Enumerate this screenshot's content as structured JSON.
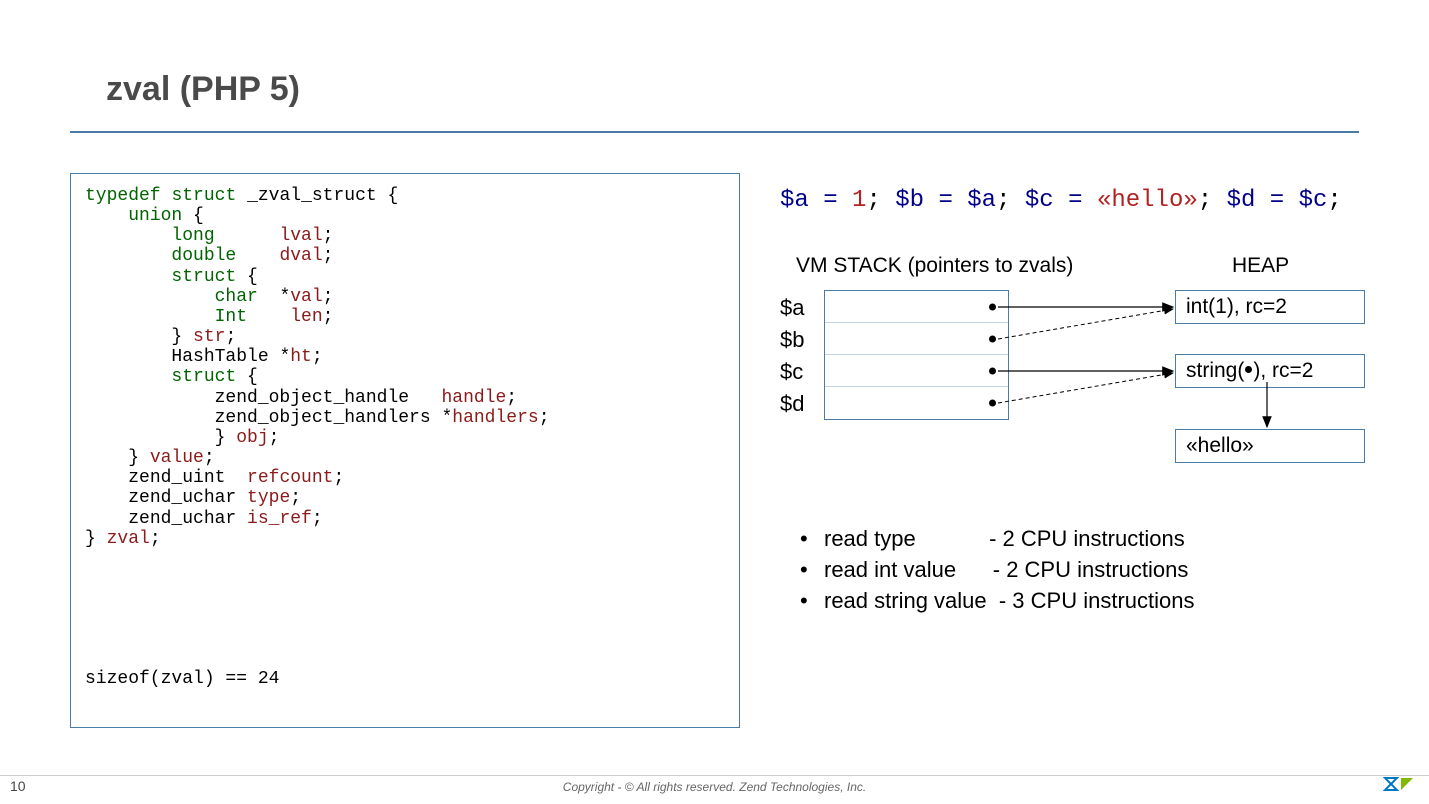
{
  "title": "zval (PHP 5)",
  "code": {
    "l1a": "typedef",
    "l1b": "struct",
    "l1c": "_zval_struct {",
    "l2a": "union",
    "l2b": " {",
    "l3a": "long",
    "l3b": "lval",
    "l3c": ";",
    "l4a": "double",
    "l4b": "dval",
    "l4c": ";",
    "l5a": "struct",
    "l5b": " {",
    "l6a": "char",
    "l6b": "  *",
    "l6c": "val",
    "l6d": ";",
    "l7a": "Int",
    "l7b": "len",
    "l7c": ";",
    "l8a": "} ",
    "l8b": "str",
    "l8c": ";",
    "l9a": "HashTable *",
    "l9b": "ht",
    "l9c": ";",
    "l10a": "struct",
    "l10b": " {",
    "l11a": "zend_object_handle",
    "l11b": "handle",
    "l11c": ";",
    "l12a": "zend_object_handlers *",
    "l12b": "handlers",
    "l12c": ";",
    "l13a": "} ",
    "l13b": "obj",
    "l13c": ";",
    "l14a": "} ",
    "l14b": "value",
    "l14c": ";",
    "l15a": "zend_uint  ",
    "l15b": "refcount",
    "l15c": ";",
    "l16a": "zend_uchar ",
    "l16b": "type",
    "l16c": ";",
    "l17a": "zend_uchar ",
    "l17b": "is_ref",
    "l17c": ";",
    "l18a": "} ",
    "l18b": "zval",
    "l18c": ";",
    "sizeof": "sizeof(zval) == 24"
  },
  "php": {
    "a": "$a",
    "eq1": " = ",
    "one": "1",
    "s1": "; ",
    "b": "$b",
    "eq2": " = ",
    "a2": "$a",
    "s2": "; ",
    "c": "$c",
    "eq3": " = ",
    "hello": "«hello»",
    "s3": "; ",
    "d": "$d",
    "eq4": " = ",
    "c2": "$c",
    "s4": ";"
  },
  "diagram": {
    "stack_header": "VM STACK (pointers to zvals)",
    "heap_header": "HEAP",
    "vars": [
      "$a",
      "$b",
      "$c",
      "$d"
    ],
    "heap_int": "int(1), rc=2",
    "heap_str_pre": "string(",
    "heap_str_post": "), rc=2",
    "heap_hello": "«hello»"
  },
  "bullets": [
    "read type            - 2 CPU instructions",
    "read int value      - 2 CPU instructions",
    "read string value  - 3 CPU instructions"
  ],
  "footer": {
    "page": "10",
    "copyright": "Copyright - © All rights reserved. Zend Technologies, Inc.",
    "logo_alt": "zend"
  }
}
